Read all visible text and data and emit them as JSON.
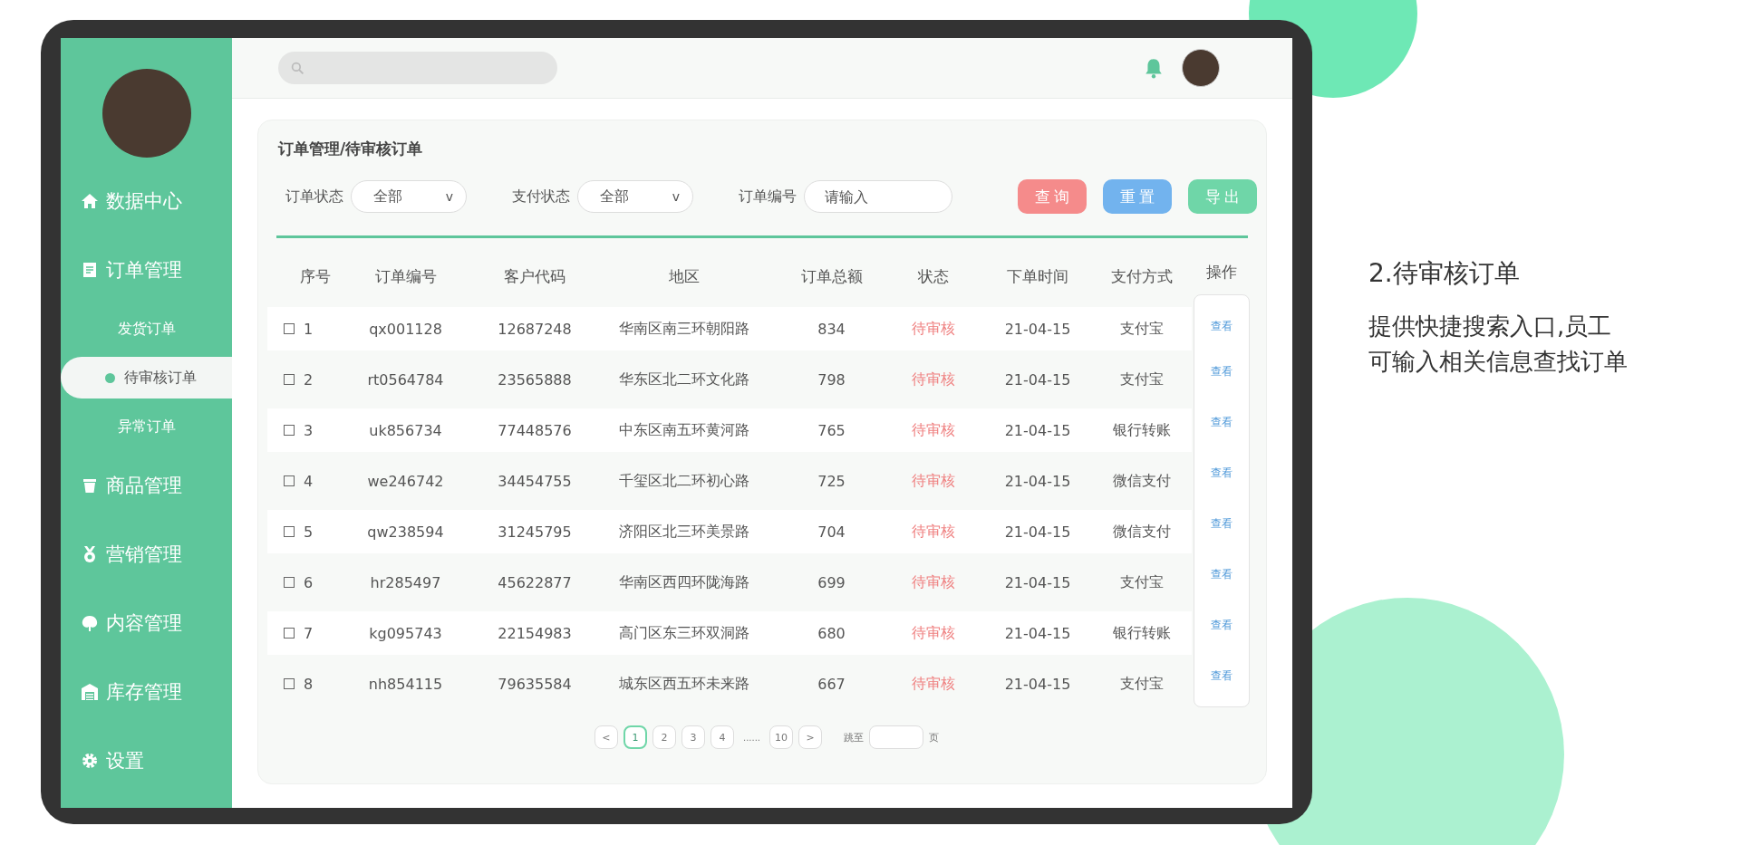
{
  "sidebar": {
    "items": [
      {
        "label": "数据中心"
      },
      {
        "label": "订单管理",
        "children": [
          {
            "label": "发货订单",
            "selected": false
          },
          {
            "label": "待审核订单",
            "selected": true
          },
          {
            "label": "异常订单",
            "selected": false
          }
        ]
      },
      {
        "label": "商品管理"
      },
      {
        "label": "营销管理"
      },
      {
        "label": "内容管理"
      },
      {
        "label": "库存管理"
      },
      {
        "label": "设置"
      }
    ]
  },
  "breadcrumb": "订单管理/待审核订单",
  "filters": [
    {
      "kind": "select",
      "label": "订单状态",
      "value": "全部",
      "caret": "v"
    },
    {
      "kind": "select",
      "label": "支付状态",
      "value": "全部",
      "caret": "v"
    },
    {
      "kind": "input",
      "label": "订单编号",
      "placeholder": "请输入"
    }
  ],
  "buttons": [
    {
      "label": "查询",
      "color": "#f58b8b"
    },
    {
      "label": "重置",
      "color": "#72b3ee"
    },
    {
      "label": "导出",
      "color": "#6fd6a8"
    }
  ],
  "table": {
    "columns": [
      "序号",
      "订单编号",
      "客户代码",
      "地区",
      "订单总额",
      "状态",
      "下单时间",
      "支付方式",
      "操作"
    ],
    "rows": [
      {
        "checked": false,
        "cells": [
          "1",
          "qx001128",
          "12687248",
          "华南区南三环朝阳路",
          "834",
          "待审核",
          "21-04-15",
          "支付宝"
        ],
        "action": "查看"
      },
      {
        "checked": false,
        "cells": [
          "2",
          "rt0564784",
          "23565888",
          "华东区北二环文化路",
          "798",
          "待审核",
          "21-04-15",
          "支付宝"
        ],
        "action": "查看"
      },
      {
        "checked": false,
        "cells": [
          "3",
          "uk856734",
          "77448576",
          "中东区南五环黄河路",
          "765",
          "待审核",
          "21-04-15",
          "银行转账"
        ],
        "action": "查看"
      },
      {
        "checked": false,
        "cells": [
          "4",
          "we246742",
          "34454755",
          "千玺区北二环初心路",
          "725",
          "待审核",
          "21-04-15",
          "微信支付"
        ],
        "action": "查看"
      },
      {
        "checked": false,
        "cells": [
          "5",
          "qw238594",
          "31245795",
          "济阳区北三环美景路",
          "704",
          "待审核",
          "21-04-15",
          "微信支付"
        ],
        "action": "查看"
      },
      {
        "checked": false,
        "cells": [
          "6",
          "hr285497",
          "45622877",
          "华南区西四环陇海路",
          "699",
          "待审核",
          "21-04-15",
          "支付宝"
        ],
        "action": "查看"
      },
      {
        "checked": false,
        "cells": [
          "7",
          "kg095743",
          "22154983",
          "高门区东三环双洞路",
          "680",
          "待审核",
          "21-04-15",
          "银行转账"
        ],
        "action": "查看"
      },
      {
        "checked": false,
        "cells": [
          "8",
          "nh854115",
          "79635584",
          "城东区西五环未来路",
          "667",
          "待审核",
          "21-04-15",
          "支付宝"
        ],
        "action": "查看"
      }
    ]
  },
  "pagination": {
    "prev": "<",
    "pages": [
      {
        "label": "1",
        "selected": true
      },
      {
        "label": "2",
        "selected": false
      },
      {
        "label": "3",
        "selected": false
      },
      {
        "label": "4",
        "selected": false
      },
      {
        "label": "......",
        "kind": "ellipsis"
      },
      {
        "label": "10",
        "selected": false
      }
    ],
    "next": ">",
    "jump_label": "跳至",
    "jump_suffix": "页"
  },
  "description": {
    "title": "2.待审核订单",
    "lines": [
      "提供快捷搜索入口,员工",
      "可输入相关信息查找订单"
    ]
  }
}
